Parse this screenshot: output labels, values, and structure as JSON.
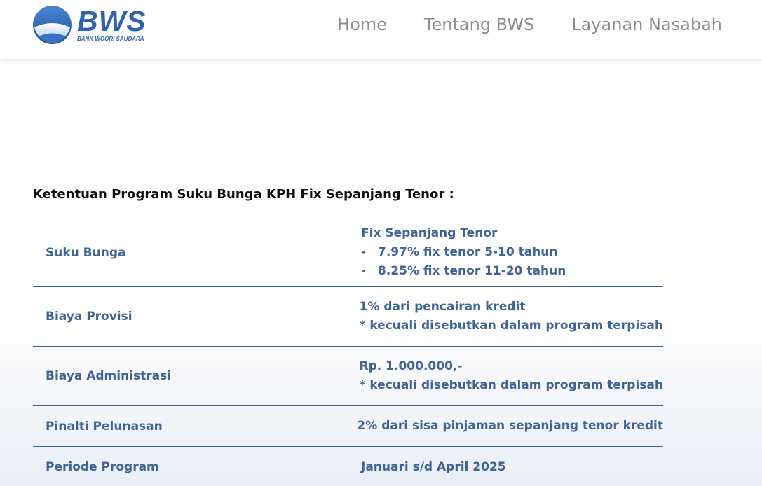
{
  "header": {
    "logo": {
      "brand": "BWS",
      "tagline": "BANK WOORI SAUDARA"
    },
    "nav": [
      {
        "label": "Home"
      },
      {
        "label": "Tentang BWS"
      },
      {
        "label": "Layanan Nasabah"
      }
    ]
  },
  "main": {
    "title": "Ketentuan Program Suku Bunga KPH Fix Sepanjang Tenor :",
    "rows": [
      {
        "label": "Suku Bunga",
        "line1": "Fix Sepanjang Tenor",
        "line2_bullet": "-",
        "line2": "7.97% fix tenor 5-10 tahun",
        "line3_bullet": "-",
        "line3": "8.25% fix tenor 11-20 tahun"
      },
      {
        "label": "Biaya Provisi",
        "line1": "1% dari pencairan kredit",
        "line2": "* kecuali disebutkan dalam program terpisah"
      },
      {
        "label": "Biaya Administrasi",
        "line1": "Rp. 1.000.000,-",
        "line2": "*  kecuali disebutkan dalam program terpisah"
      },
      {
        "label": "Pinalti Pelunasan",
        "line1": "2% dari sisa pinjaman sepanjang tenor kredit"
      },
      {
        "label": "Periode Program",
        "line1": "Januari s/d April 2025"
      }
    ]
  },
  "colors": {
    "brand_blue": "#2f61ad",
    "text_blue": "#3e6496",
    "nav_gray": "#8c8c8c"
  }
}
